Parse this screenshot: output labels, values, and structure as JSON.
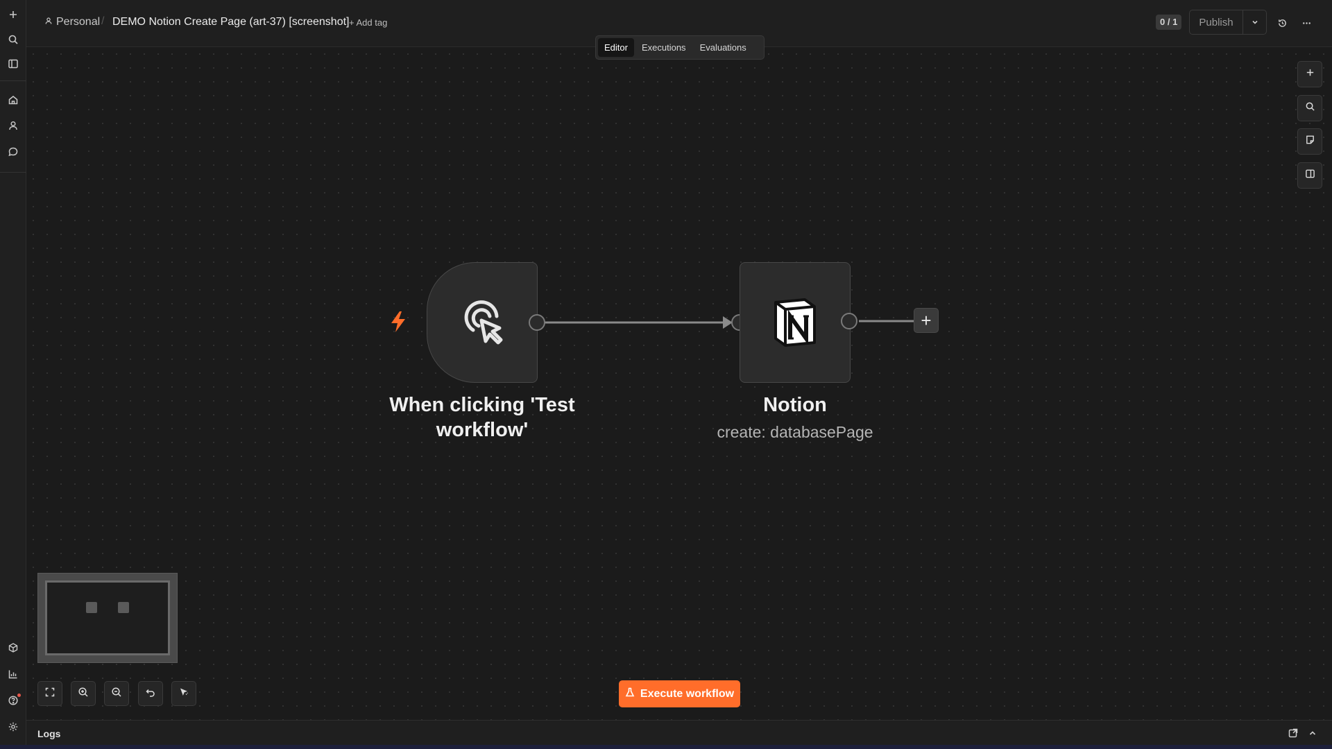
{
  "header": {
    "project_label": "Personal",
    "separator": "/",
    "workflow_title": "DEMO Notion Create Page (art-37) [screenshot]",
    "add_tag_label": "+ Add tag",
    "counter_label": "0 / 1",
    "publish_label": "Publish"
  },
  "tabs": [
    {
      "label": "Editor",
      "active": true
    },
    {
      "label": "Executions",
      "active": false
    },
    {
      "label": "Evaluations",
      "active": false
    }
  ],
  "nodes": {
    "trigger": {
      "label": "When clicking 'Test workflow'",
      "icon": "cursor-click-icon"
    },
    "notion": {
      "label": "Notion",
      "subtitle": "create: databasePage",
      "icon": "notion-logo-icon"
    }
  },
  "execute_label": "Execute workflow",
  "logs_label": "Logs",
  "colors": {
    "accent": "#ff6d2a",
    "canvas_bg": "#1b1b1b",
    "node_bg": "#2c2c2c"
  },
  "left_sidebar_icons": [
    "plus-icon",
    "search-icon",
    "panel-icon",
    "home-icon",
    "user-icon",
    "chat-icon",
    "templates-icon",
    "insights-icon",
    "help-icon",
    "settings-icon"
  ],
  "right_toolbar_icons": [
    "plus-icon",
    "search-icon",
    "sticky-note-icon",
    "side-panel-icon"
  ],
  "canvas_controls": [
    "fit-view-icon",
    "zoom-in-icon",
    "zoom-out-icon",
    "reset-zoom-icon",
    "tidy-up-icon"
  ]
}
